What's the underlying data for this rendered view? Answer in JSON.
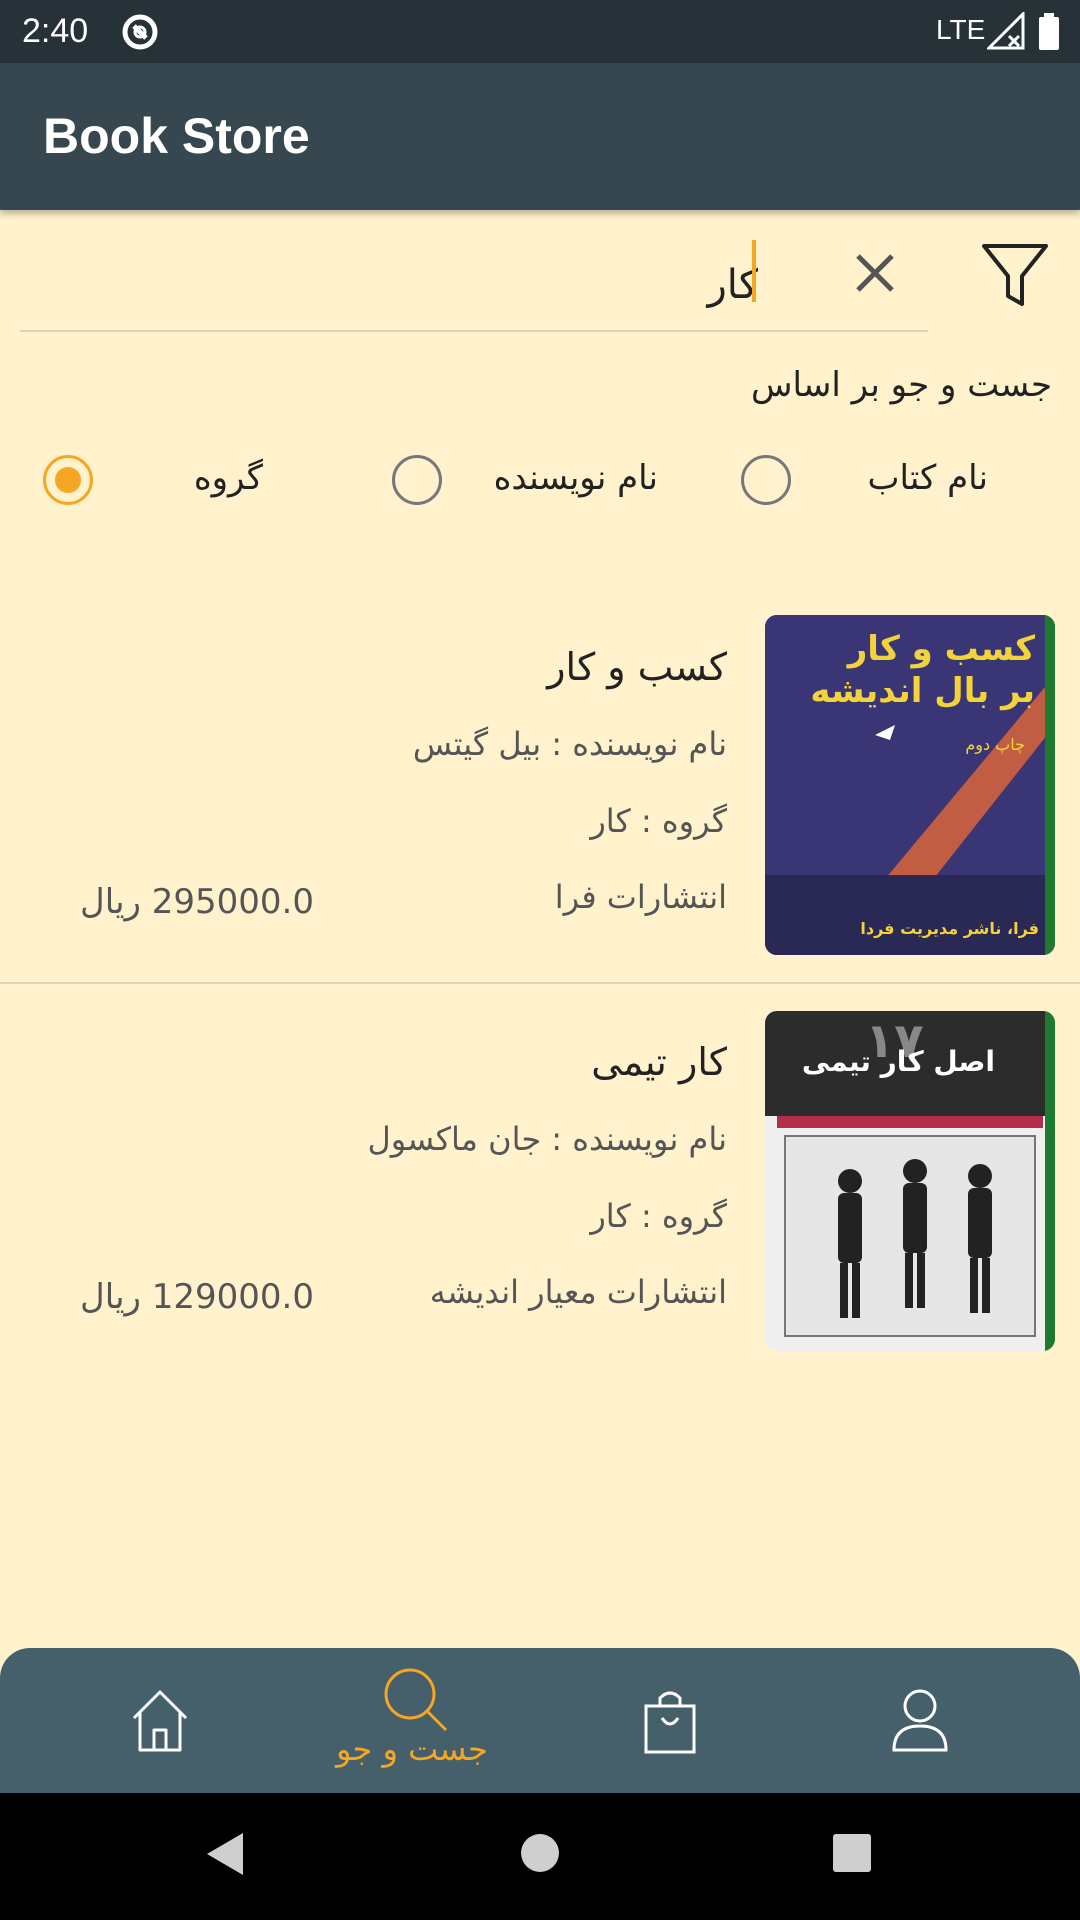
{
  "status_bar": {
    "time": "2:40",
    "network": "LTE"
  },
  "app_bar": {
    "title": "Book Store"
  },
  "search": {
    "value": "کار",
    "search_by_label": "جست و جو بر اساس"
  },
  "search_options": [
    {
      "label": "نام کتاب",
      "checked": false
    },
    {
      "label": "نام نویسنده",
      "checked": false
    },
    {
      "label": "گروه",
      "checked": true
    }
  ],
  "results": [
    {
      "title": "کسب و کار",
      "author": "نام نویسنده : بیل گیتس",
      "group": "گروه : کار",
      "publisher": "انتشارات فرا",
      "price": "295000.0 ریال",
      "cover": {
        "title_line1": "کسب و کار",
        "title_line2": "بر بال اندیشه",
        "badge": "چاپ دوم",
        "footer": "فرا، ناشر مدیریت فردا"
      }
    },
    {
      "title": "کار تیمی",
      "author": "نام نویسنده : جان ماکسول",
      "group": "گروه : کار",
      "publisher": "انتشارات معیار اندیشه",
      "price": "129000.0 ریال",
      "cover": {
        "number": "۱۷",
        "title_line1": "اصل کار تیمی"
      }
    }
  ],
  "bottom_nav": {
    "search_label": "جست و جو"
  },
  "colors": {
    "accent": "#F5A623",
    "app_bar": "#37474F",
    "background": "#FFF2CC",
    "bottom_nav": "#455F6B"
  }
}
